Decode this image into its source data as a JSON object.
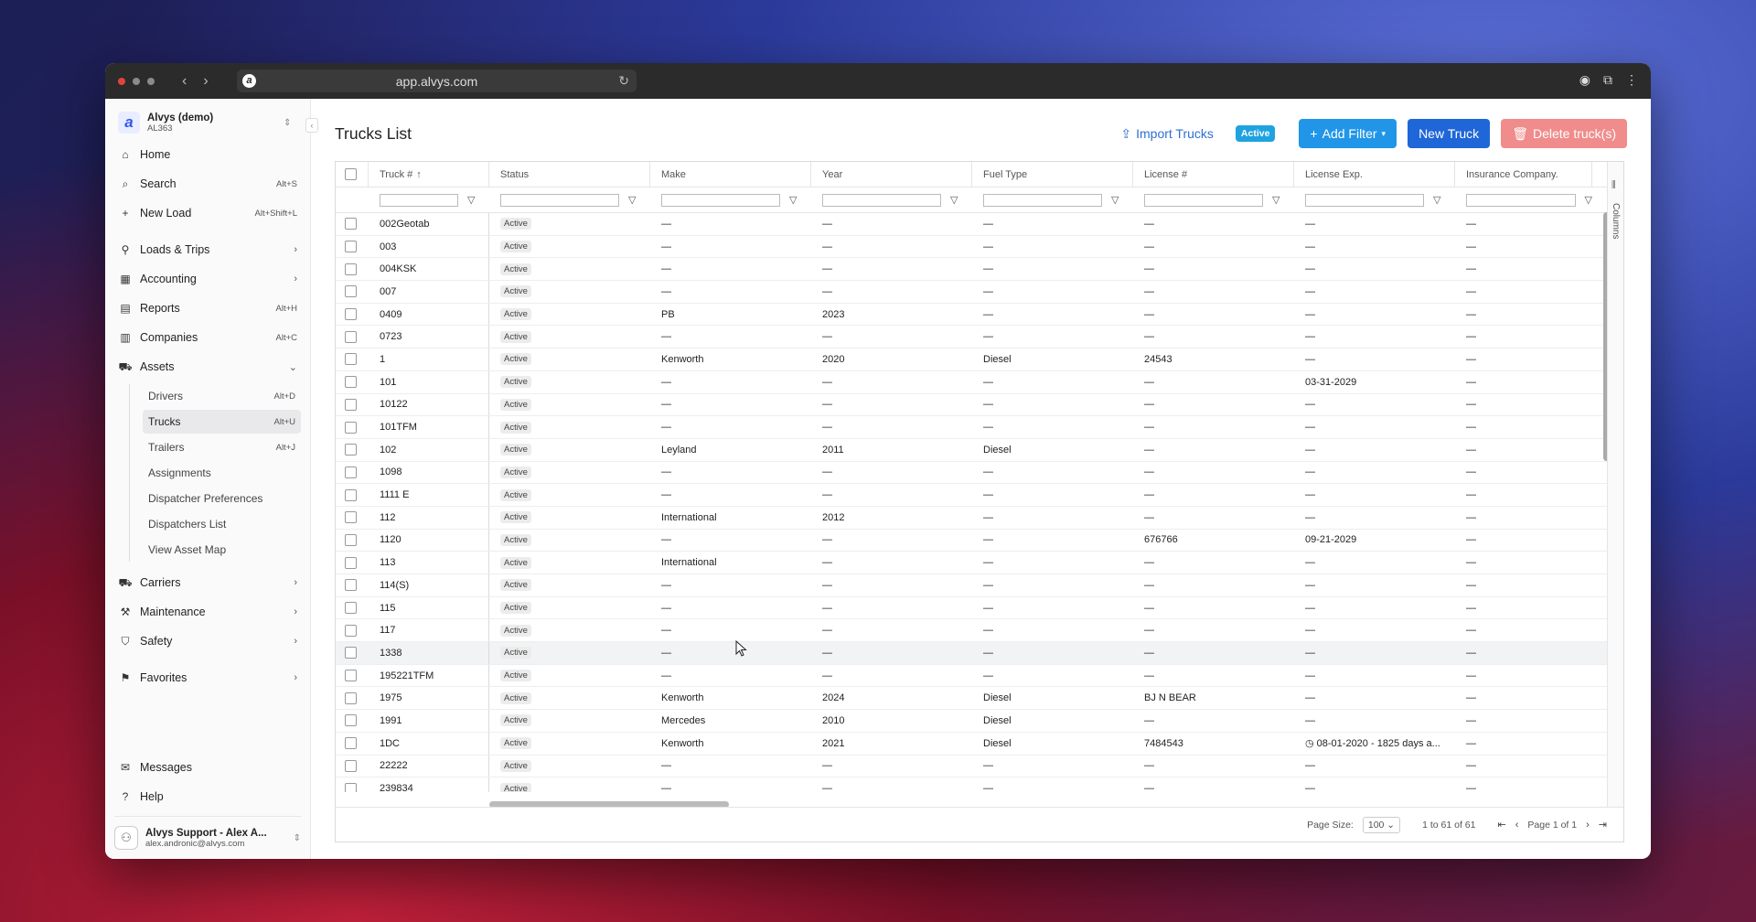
{
  "browser": {
    "url": "app.alvys.com"
  },
  "org": {
    "name": "Alvys (demo)",
    "code": "AL363"
  },
  "nav": {
    "home": "Home",
    "search": "Search",
    "search_sc": "Alt+S",
    "newload": "New Load",
    "newload_sc": "Alt+Shift+L",
    "loads": "Loads & Trips",
    "accounting": "Accounting",
    "reports": "Reports",
    "reports_sc": "Alt+H",
    "companies": "Companies",
    "companies_sc": "Alt+C",
    "assets": "Assets",
    "carriers": "Carriers",
    "maintenance": "Maintenance",
    "safety": "Safety",
    "favorites": "Favorites",
    "messages": "Messages",
    "help": "Help"
  },
  "assets_sub": [
    {
      "label": "Drivers",
      "sc": "Alt+D"
    },
    {
      "label": "Trucks",
      "sc": "Alt+U"
    },
    {
      "label": "Trailers",
      "sc": "Alt+J"
    },
    {
      "label": "Assignments",
      "sc": ""
    },
    {
      "label": "Dispatcher Preferences",
      "sc": ""
    },
    {
      "label": "Dispatchers List",
      "sc": ""
    },
    {
      "label": "View Asset Map",
      "sc": ""
    }
  ],
  "user": {
    "name": "Alvys Support - Alex A...",
    "email": "alex.andronic@alvys.com"
  },
  "header": {
    "title": "Trucks List",
    "import": "Import Trucks",
    "active_pill": "Active",
    "add_filter": "Add Filter",
    "new_truck": "New Truck",
    "delete": "Delete truck(s)"
  },
  "columns": [
    "Truck #",
    "Status",
    "Make",
    "Year",
    "Fuel Type",
    "License #",
    "License Exp.",
    "Insurance Company."
  ],
  "columns_tab": "Columns",
  "rows": [
    [
      "002Geotab",
      "Active",
      "—",
      "—",
      "—",
      "—",
      "—",
      "—"
    ],
    [
      "003",
      "Active",
      "—",
      "—",
      "—",
      "—",
      "—",
      "—"
    ],
    [
      "004KSK",
      "Active",
      "—",
      "—",
      "—",
      "—",
      "—",
      "—"
    ],
    [
      "007",
      "Active",
      "—",
      "—",
      "—",
      "—",
      "—",
      "—"
    ],
    [
      "0409",
      "Active",
      "PB",
      "2023",
      "—",
      "—",
      "—",
      "—"
    ],
    [
      "0723",
      "Active",
      "—",
      "—",
      "—",
      "—",
      "—",
      "—"
    ],
    [
      "1",
      "Active",
      "Kenworth",
      "2020",
      "Diesel",
      "24543",
      "—",
      "—"
    ],
    [
      "101",
      "Active",
      "—",
      "—",
      "—",
      "—",
      "03-31-2029",
      "—"
    ],
    [
      "10122",
      "Active",
      "—",
      "—",
      "—",
      "—",
      "—",
      "—"
    ],
    [
      "101TFM",
      "Active",
      "—",
      "—",
      "—",
      "—",
      "—",
      "—"
    ],
    [
      "102",
      "Active",
      "Leyland",
      "2011",
      "Diesel",
      "—",
      "—",
      "—"
    ],
    [
      "1098",
      "Active",
      "—",
      "—",
      "—",
      "—",
      "—",
      "—"
    ],
    [
      "1111 E",
      "Active",
      "—",
      "—",
      "—",
      "—",
      "—",
      "—"
    ],
    [
      "112",
      "Active",
      "International",
      "2012",
      "—",
      "—",
      "—",
      "—"
    ],
    [
      "1120",
      "Active",
      "—",
      "—",
      "—",
      "676766",
      "09-21-2029",
      "—"
    ],
    [
      "113",
      "Active",
      "International",
      "—",
      "—",
      "—",
      "—",
      "—"
    ],
    [
      "114(S)",
      "Active",
      "—",
      "—",
      "—",
      "—",
      "—",
      "—"
    ],
    [
      "115",
      "Active",
      "—",
      "—",
      "—",
      "—",
      "—",
      "—"
    ],
    [
      "117",
      "Active",
      "—",
      "—",
      "—",
      "—",
      "—",
      "—"
    ],
    [
      "1338",
      "Active",
      "—",
      "—",
      "—",
      "—",
      "—",
      "—"
    ],
    [
      "195221TFM",
      "Active",
      "—",
      "—",
      "—",
      "—",
      "—",
      "—"
    ],
    [
      "1975",
      "Active",
      "Kenworth",
      "2024",
      "Diesel",
      "BJ N BEAR",
      "—",
      "—"
    ],
    [
      "1991",
      "Active",
      "Mercedes",
      "2010",
      "Diesel",
      "—",
      "—",
      "—"
    ],
    [
      "1DC",
      "Active",
      "Kenworth",
      "2021",
      "Diesel",
      "7484543",
      "◷ 08-01-2020 - 1825 days a...",
      "—"
    ],
    [
      "22222",
      "Active",
      "—",
      "—",
      "—",
      "—",
      "—",
      "—"
    ],
    [
      "239834",
      "Active",
      "—",
      "—",
      "—",
      "—",
      "—",
      "—"
    ]
  ],
  "highlight_row": 19,
  "footer": {
    "page_size_label": "Page Size:",
    "page_size": "100",
    "range": "1 to 61 of 61",
    "page": "Page 1 of 1"
  }
}
